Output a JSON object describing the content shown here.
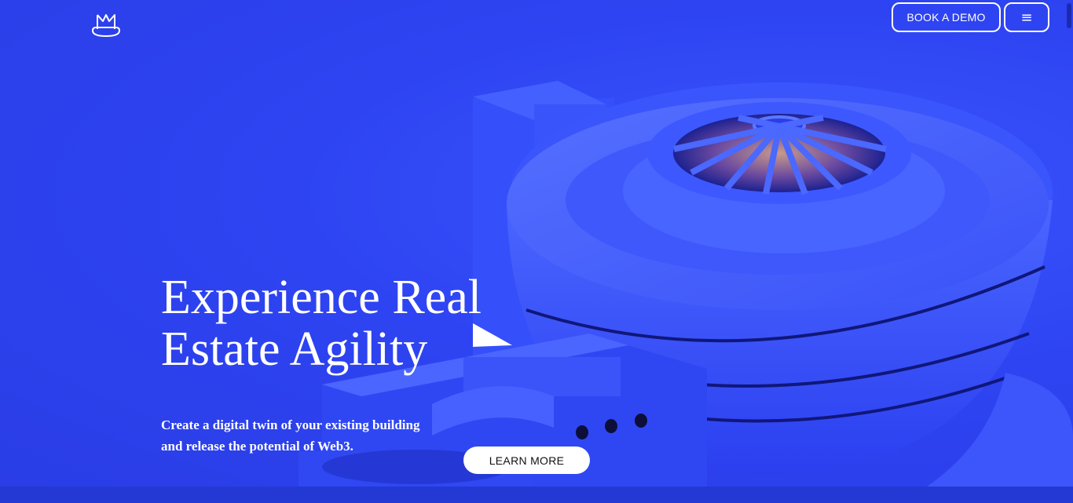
{
  "header": {
    "logo_icon": "museum-m-logo",
    "book_demo_label": "BOOK A DEMO",
    "menu_icon": "hamburger-menu-icon",
    "menu_glyph": "≡"
  },
  "hero": {
    "headline_line1": "Experience Real",
    "headline_line2": "Estate Agility",
    "arrow_icon": "play-arrow-icon",
    "subtext_line1": "Create a digital twin of your existing building",
    "subtext_line2": "and release the potential of Web3.",
    "learn_more_label": "LEARN MORE",
    "image": "blue-spiral-museum-building-3d-render"
  },
  "colors": {
    "background": "#2f45f0",
    "text": "#ffffff",
    "button_fill": "#ffffff",
    "button_text": "#111111"
  }
}
